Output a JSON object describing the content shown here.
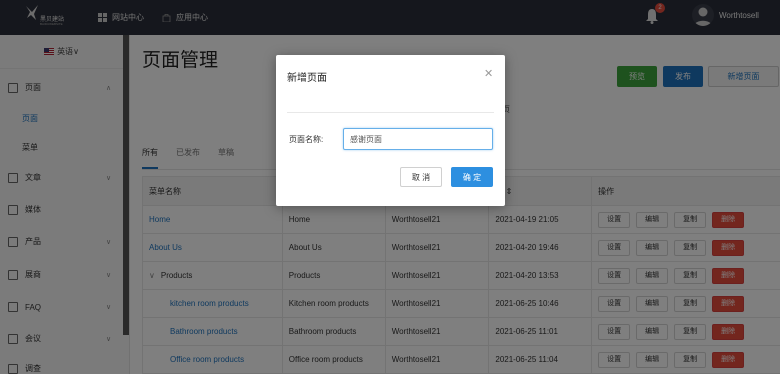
{
  "topbar": {
    "logo_text": "黑贝建站",
    "logo_subtext": "BAIDUWEBSITE",
    "nav": [
      {
        "label": "网站中心",
        "icon": "grid-icon"
      },
      {
        "label": "应用中心",
        "icon": "bag-icon"
      }
    ],
    "notification_count": "2",
    "username": "Worthtosell"
  },
  "sidebar": {
    "language": "英语",
    "items": [
      {
        "label": "页面",
        "icon": "page-icon"
      },
      {
        "label": "页面",
        "sub": true
      },
      {
        "label": "菜单",
        "sub": true
      },
      {
        "label": "文章",
        "icon": "article-icon"
      },
      {
        "label": "媒体",
        "icon": "media-icon"
      },
      {
        "label": "产品",
        "icon": "product-icon"
      },
      {
        "label": "展商",
        "icon": "exhibitor-icon"
      },
      {
        "label": "FAQ",
        "icon": "faq-icon"
      },
      {
        "label": "会议",
        "icon": "meeting-icon"
      },
      {
        "label": "调查",
        "icon": "survey-icon"
      }
    ]
  },
  "main": {
    "title": "页面管理",
    "buttons": {
      "preview": "预览",
      "publish": "发布",
      "new_page": "新增页面"
    },
    "tabs": [
      "所有",
      "已发布",
      "草稿"
    ],
    "header_fragment": "页",
    "table": {
      "headers": [
        "菜单名称",
        "",
        "",
        "间 ⇕",
        "操作"
      ],
      "rows": [
        {
          "menu": "Home",
          "page": "Home",
          "author": "Worthtosell21",
          "time": "2021-04-19 21:05"
        },
        {
          "menu": "About Us",
          "page": "About Us",
          "author": "Worthtosell21",
          "time": "2021-04-20 19:46"
        },
        {
          "menu": "Products",
          "page": "Products",
          "author": "Worthtosell21",
          "time": "2021-04-20 13:53"
        },
        {
          "menu": "kitchen room products",
          "page": "Kitchen room products",
          "author": "Worthtosell21",
          "time": "2021-06-25 10:46"
        },
        {
          "menu": "Bathroom products",
          "page": "Bathroom products",
          "author": "Worthtosell21",
          "time": "2021-06-25 11:01"
        },
        {
          "menu": "Office room products",
          "page": "Office room products",
          "author": "Worthtosell21",
          "time": "2021-06-25 11:04"
        }
      ],
      "actions": [
        "设置",
        "编辑",
        "复制",
        "删除"
      ]
    }
  },
  "modal": {
    "title": "新增页面",
    "field_label": "页面名称:",
    "field_value": "感谢页面",
    "cancel": "取 消",
    "confirm": "确 定"
  },
  "colors": {
    "topbar": "#2b2f3a",
    "primary": "#1e73be",
    "success": "#3ca43c",
    "danger": "#e74c3c"
  }
}
